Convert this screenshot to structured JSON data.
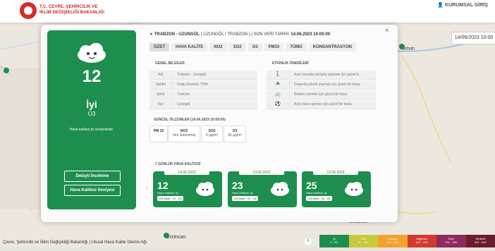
{
  "header": {
    "org_line1": "T.C. ÇEVRE, ŞEHİRCİLİK VE",
    "org_line2": "İKLİM DEĞİŞİKLİĞİ BAKANLIĞI",
    "login_label": "KURUMSAL GİRİŞ"
  },
  "map": {
    "date": "14/06/2023 10:00",
    "cities": [
      "Artvin",
      "Erzurum",
      "Erzincan"
    ],
    "footer": "Çevre, Şehircilik ve İklim Değişikliği Bakanlığı | Ulusal Hava Kalite İzleme Ağı",
    "legend": [
      {
        "label": "İyi",
        "range": "0 - 50",
        "color": "#1e8e4e"
      },
      {
        "label": "Orta",
        "range": "51 - 100",
        "color": "#c7c93a"
      },
      {
        "label": "Hassas",
        "range": "101 - 150",
        "color": "#f2a22c"
      },
      {
        "label": "Sağlıksız",
        "range": "151 - 200",
        "color": "#d13b2f"
      },
      {
        "label": "Kötü",
        "range": "201 - 300",
        "color": "#8e2a5e"
      },
      {
        "label": "Tehlikeli",
        "range": "301 - 500",
        "color": "#6b1c2c"
      }
    ]
  },
  "station": {
    "location": "TRABZON - UZUNGÖL",
    "subtitle": "( UZUNGÖL / TRABZON )",
    "last_label": "SON VERİ TARİHİ:",
    "last_date": "14.06.2023 10:00:00"
  },
  "tabs": [
    "ÖZET",
    "HAVA KALİTE",
    "NO2",
    "SO2",
    "O3",
    "PM10",
    "TÜMÜ",
    "KONSANTRASYON"
  ],
  "summary": {
    "index": "12",
    "quality": "İyi",
    "pollutant": "O3",
    "description": "Hava kalitesi iyi seviyededir.",
    "detail_button": "Detaylı İnceleme",
    "level_button": "Hava Kalitesi Seviyesi"
  },
  "general": {
    "title": "GENEL BİLGİLER",
    "rows": [
      {
        "k": "Adı",
        "v": "Trabzon - Uzungöl"
      },
      {
        "k": "Sahibi",
        "v": "Doğu Anadolu THM"
      },
      {
        "k": "Şehir",
        "v": "Trabzon"
      },
      {
        "k": "İlçe",
        "v": "Uzungöl"
      }
    ]
  },
  "activities": {
    "title": "ETKİNLİK ÖNERİLERİ",
    "rows": [
      "Açık havada yürüyüş yapmak için güzel b...",
      "Dışarıda piknik yapmak için güzel bir hava.",
      "Bisiklet sürmek için güzel bir hava.",
      "Açık hava sporları için güzel bir hava."
    ]
  },
  "measurements": {
    "title": "GÜNCEL ÖLÇÜMLER (14.06.2023 10:00:00)",
    "items": [
      {
        "name": "PM 10",
        "value": "-"
      },
      {
        "name": "NO2",
        "value": "Veri Gelmemiş"
      },
      {
        "name": "SO2",
        "value": "6 μg/m³"
      },
      {
        "name": "O3",
        "value": "35 μg/m³"
      }
    ]
  },
  "forecast": {
    "title": "7 GÜNLÜK HAVA KALİTESİ",
    "days": [
      {
        "date": "14.06.2023",
        "index": "12",
        "label": "Hava Kalitesi: İyi",
        "pollutant": "O3 Adeti : 10 - 15"
      },
      {
        "date": "13.06.2023",
        "index": "23",
        "label": "Hava Kalitesi: İyi",
        "pollutant": "O3 Adeti : 22 - 23"
      },
      {
        "date": "12.06.2023",
        "index": "25",
        "label": "Hava Kalitesi: İyi",
        "pollutant": "O3 Adeti : 22 - 25"
      }
    ]
  }
}
